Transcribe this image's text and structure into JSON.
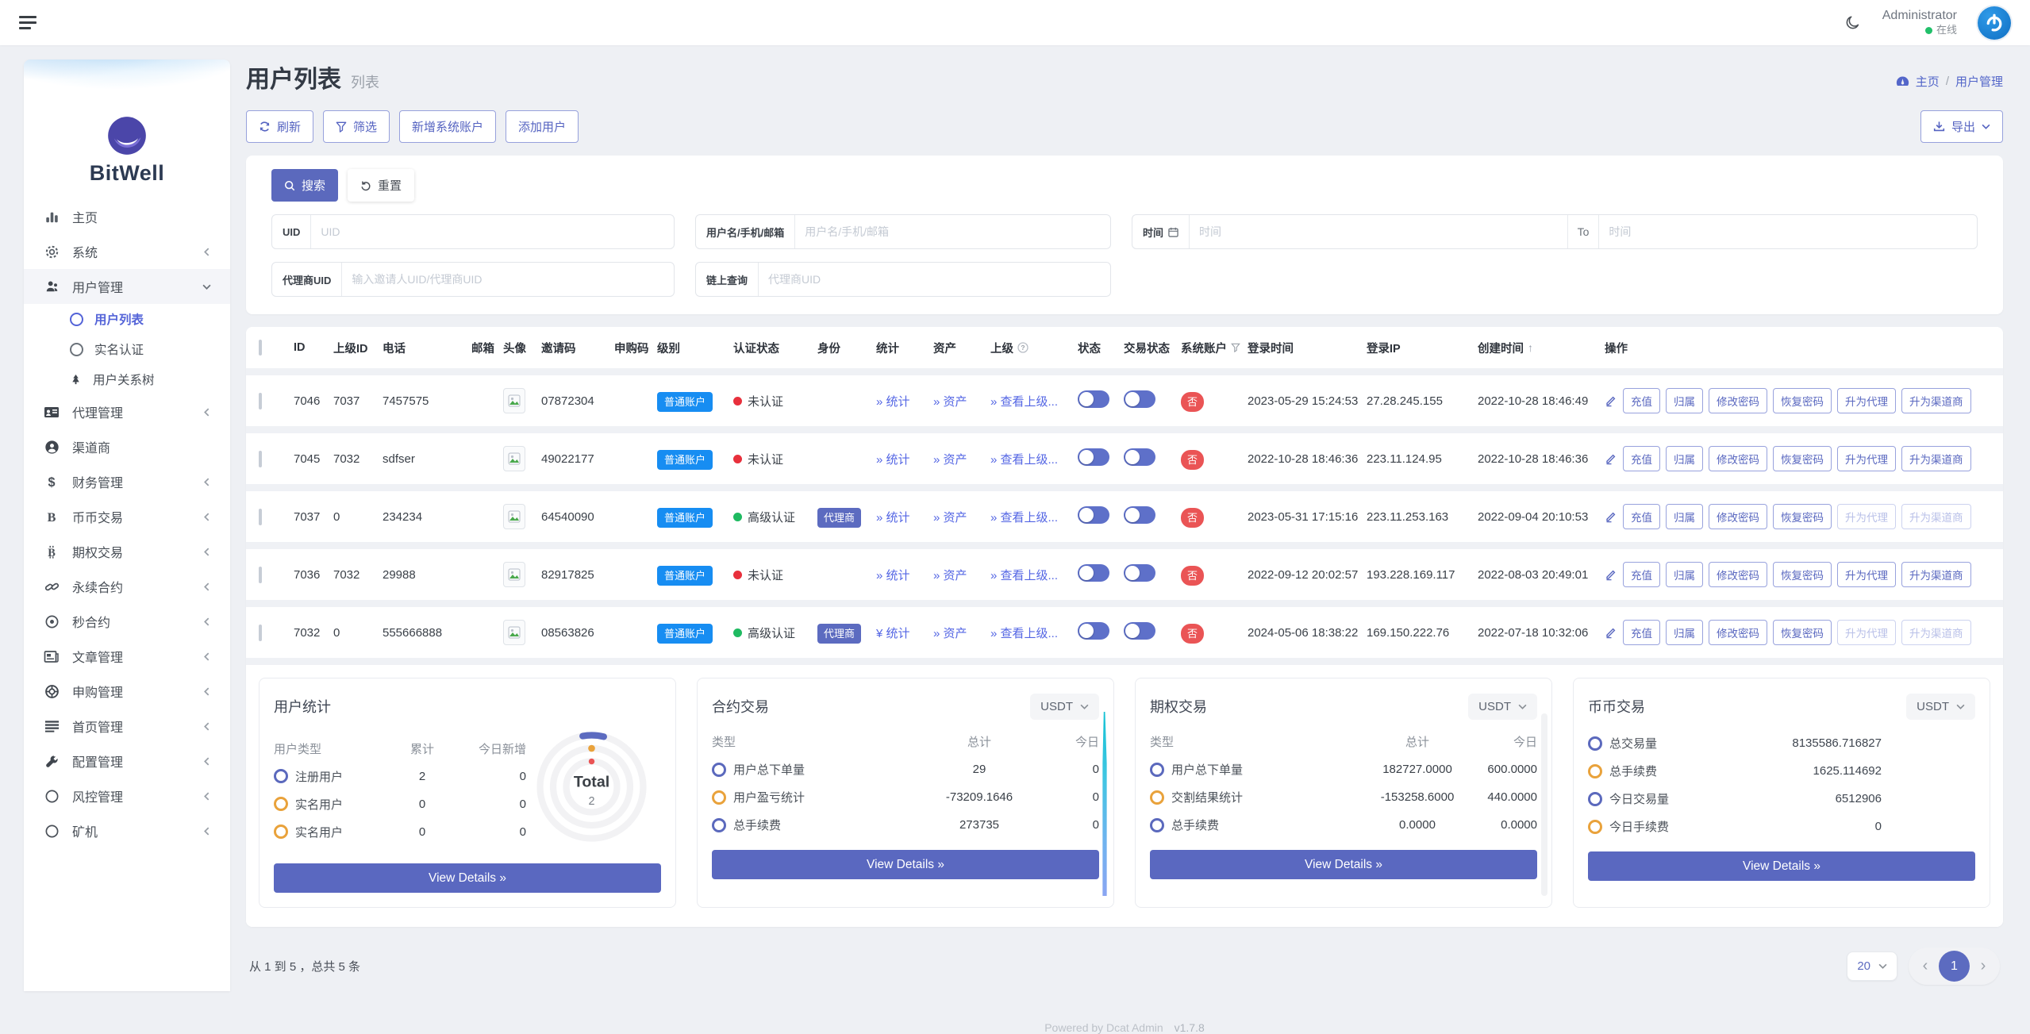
{
  "colors": {
    "primary": "#5b69bd",
    "link": "#5365e4",
    "badge_blue": "#178df2",
    "badge_purple": "#5c6bc0",
    "badge_red": "#ea5455",
    "dot_red": "#e8303c",
    "dot_green": "#1fba61",
    "bullet_orange": "#e9a23b"
  },
  "navbar": {
    "user_name": "Administrator",
    "user_status": "在线",
    "moon_icon": "moon-icon",
    "avatar_icon": "power-logo-icon"
  },
  "breadcrumb": {
    "home": "主页",
    "separator": "/",
    "current": "用户管理",
    "icon": "dashboard-icon"
  },
  "sidebar": {
    "brand": "BitWell",
    "items": [
      {
        "label": "主页",
        "icon": "chart-bar-icon"
      },
      {
        "label": "系统",
        "icon": "gear-icon",
        "chevron": "left"
      },
      {
        "label": "用户管理",
        "icon": "users-icon",
        "chevron": "down",
        "active": true
      },
      {
        "label": "代理管理",
        "icon": "id-card-icon",
        "chevron": "left"
      },
      {
        "label": "渠道商",
        "icon": "user-circle-icon"
      },
      {
        "label": "财务管理",
        "icon": "dollar-icon",
        "chevron": "left"
      },
      {
        "label": "币币交易",
        "icon": "currency-b-icon",
        "chevron": "left"
      },
      {
        "label": "期权交易",
        "icon": "bitcoin-icon",
        "chevron": "left"
      },
      {
        "label": "永续合约",
        "icon": "chain-icon",
        "chevron": "left"
      },
      {
        "label": "秒合约",
        "icon": "target-icon",
        "chevron": "left"
      },
      {
        "label": "文章管理",
        "icon": "newspaper-icon",
        "chevron": "left"
      },
      {
        "label": "申购管理",
        "icon": "life-ring-icon",
        "chevron": "left"
      },
      {
        "label": "首页管理",
        "icon": "list-icon",
        "chevron": "left"
      },
      {
        "label": "配置管理",
        "icon": "wrench-icon",
        "chevron": "left"
      },
      {
        "label": "风控管理",
        "icon": "circle-icon",
        "chevron": "left"
      },
      {
        "label": "矿机",
        "icon": "circle-icon",
        "chevron": "left"
      }
    ],
    "user_children": [
      {
        "label": "用户列表",
        "icon": "circle-icon",
        "active": true
      },
      {
        "label": "实名认证",
        "icon": "circle-icon"
      },
      {
        "label": "用户关系树",
        "icon": "tree-icon"
      }
    ]
  },
  "page": {
    "title": "用户列表",
    "subtitle": "列表"
  },
  "toolbar": {
    "refresh": "刷新",
    "filter": "筛选",
    "add_system_account": "新增系统账户",
    "add_user": "添加用户",
    "export": "导出"
  },
  "search": {
    "search_btn": "搜索",
    "reset_btn": "重置",
    "fields": {
      "uid": {
        "label": "UID",
        "placeholder": "UID"
      },
      "account": {
        "label": "用户名/手机/邮箱",
        "placeholder": "用户名/手机/邮箱"
      },
      "time": {
        "label": "时间",
        "from_placeholder": "时间",
        "to_label": "To",
        "to_placeholder": "时间"
      },
      "agent": {
        "label": "代理商UID",
        "placeholder": "输入邀请人UID/代理商UID"
      },
      "chain": {
        "label": "链上查询",
        "placeholder": "代理商UID"
      }
    }
  },
  "table": {
    "headers": [
      "ID",
      "上级ID",
      "电话",
      "邮箱",
      "头像",
      "邀请码",
      "申购码",
      "级别",
      "认证状态",
      "身份",
      "统计",
      "资产",
      "上级",
      "状态",
      "交易状态",
      "系统账户",
      "登录时间",
      "登录IP",
      "创建时间",
      "操作"
    ],
    "links": {
      "stats": "统计",
      "assets": "资产",
      "parent": "查看上级...",
      "prefix": "»"
    },
    "actions": [
      "充值",
      "归属",
      "修改密码",
      "恢复密码",
      "升为代理",
      "升为渠道商"
    ],
    "rows": [
      {
        "id": "7046",
        "parent_id": "7037",
        "phone": "7457575",
        "invite_code": "07872304",
        "level": "普通账户",
        "auth_status": "未认证",
        "identity": "",
        "stats_prefix": "»",
        "system_account": "否",
        "login_time": "2023-05-29 15:24:53",
        "login_ip": "27.28.245.155",
        "created_at": "2022-10-28 18:46:49"
      },
      {
        "id": "7045",
        "parent_id": "7032",
        "phone": "sdfser",
        "invite_code": "49022177",
        "level": "普通账户",
        "auth_status": "未认证",
        "identity": "",
        "stats_prefix": "»",
        "system_account": "否",
        "login_time": "2022-10-28 18:46:36",
        "login_ip": "223.11.124.95",
        "created_at": "2022-10-28 18:46:36"
      },
      {
        "id": "7037",
        "parent_id": "0",
        "phone": "234234",
        "invite_code": "64540090",
        "level": "普通账户",
        "auth_status": "高级认证",
        "identity": "代理商",
        "stats_prefix": "»",
        "system_account": "否",
        "login_time": "2023-05-31 17:15:16",
        "login_ip": "223.11.253.163",
        "created_at": "2022-09-04 20:10:53"
      },
      {
        "id": "7036",
        "parent_id": "7032",
        "phone": "29988",
        "invite_code": "82917825",
        "level": "普通账户",
        "auth_status": "未认证",
        "identity": "",
        "stats_prefix": "»",
        "system_account": "否",
        "login_time": "2022-09-12 20:02:57",
        "login_ip": "193.228.169.117",
        "created_at": "2022-08-03 20:49:01"
      },
      {
        "id": "7032",
        "parent_id": "0",
        "phone": "555666888",
        "invite_code": "08563826",
        "level": "普通账户",
        "auth_status": "高级认证",
        "identity": "代理商",
        "stats_prefix": "¥",
        "system_account": "否",
        "login_time": "2024-05-06 18:38:22",
        "login_ip": "169.150.222.76",
        "created_at": "2022-07-18 10:32:06"
      }
    ]
  },
  "cards": {
    "user_stats": {
      "title": "用户统计",
      "columns": [
        "用户类型",
        "累计",
        "今日新增"
      ],
      "rows": [
        {
          "label": "注册用户",
          "total": "2",
          "today": "0"
        },
        {
          "label": "实名用户",
          "total": "0",
          "today": "0"
        },
        {
          "label": "实名用户",
          "total": "0",
          "today": "0"
        }
      ],
      "donut_center_label": "Total",
      "donut_center_value": "2",
      "view_details": "View Details »"
    },
    "contract": {
      "title": "合约交易",
      "currency": "USDT",
      "columns": [
        "类型",
        "总计",
        "今日"
      ],
      "rows": [
        {
          "label": "用户总下单量",
          "total": "29",
          "today": "0"
        },
        {
          "label": "用户盈亏统计",
          "total": "-73209.1646",
          "today": "0"
        },
        {
          "label": "总手续费",
          "total": "273735",
          "today": "0"
        }
      ],
      "view_details": "View Details »"
    },
    "options": {
      "title": "期权交易",
      "currency": "USDT",
      "columns": [
        "类型",
        "总计",
        "今日"
      ],
      "rows": [
        {
          "label": "用户总下单量",
          "total": "182727.0000",
          "today": "600.0000"
        },
        {
          "label": "交割结果统计",
          "total": "-153258.6000",
          "today": "440.0000"
        },
        {
          "label": "总手续费",
          "total": "0.0000",
          "today": "0.0000"
        }
      ],
      "view_details": "View Details »"
    },
    "spot": {
      "title": "币币交易",
      "currency": "USDT",
      "rows": [
        {
          "label": "总交易量",
          "value": "8135586.716827"
        },
        {
          "label": "总手续费",
          "value": "1625.114692"
        },
        {
          "label": "今日交易量",
          "value": "6512906"
        },
        {
          "label": "今日手续费",
          "value": "0"
        }
      ],
      "view_details": "View Details »"
    }
  },
  "pagination": {
    "summary": "从 1 到 5 ，总共 5 条",
    "page_size": "20",
    "current": "1"
  },
  "footer": {
    "powered": "Powered by Dcat Admin",
    "version": "v1.7.8"
  }
}
